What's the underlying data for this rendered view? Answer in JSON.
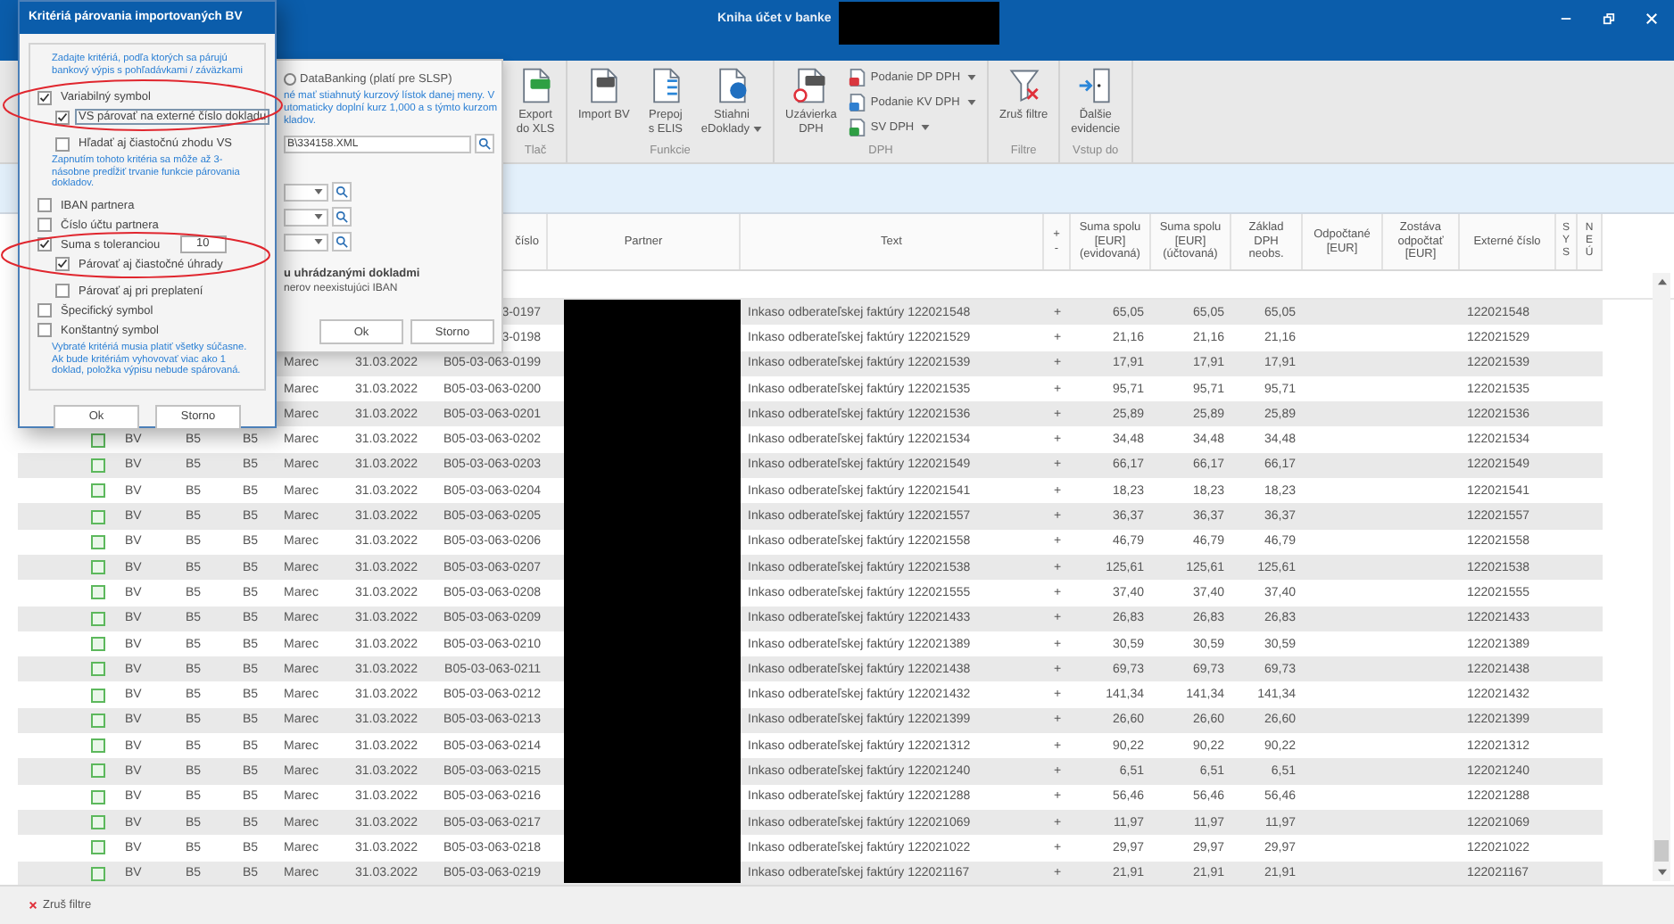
{
  "window": {
    "title": "Kniha účet v banke"
  },
  "ribbon": {
    "groups": [
      {
        "label": "Tlač",
        "items": [
          {
            "kind": "large",
            "label": "Export\ndo XLS",
            "dropdown": false
          }
        ]
      },
      {
        "label": "Funkcie",
        "items": [
          {
            "kind": "large",
            "label": "Import BV",
            "dropdown": false
          },
          {
            "kind": "large",
            "label": "Prepoj\ns ELIS",
            "dropdown": false
          },
          {
            "kind": "large",
            "label": "Stiahni\neDoklady",
            "dropdown": true
          }
        ]
      },
      {
        "label": "DPH",
        "items": [
          {
            "kind": "large",
            "label": "Uzávierka\nDPH",
            "dropdown": false
          },
          {
            "kind": "stack",
            "items": [
              {
                "label": "Podanie DP DPH",
                "dropdown": true
              },
              {
                "label": "Podanie KV DPH",
                "dropdown": true
              },
              {
                "label": "SV DPH",
                "dropdown": true
              }
            ]
          }
        ]
      },
      {
        "label": "Filtre",
        "items": [
          {
            "kind": "large",
            "label": "Zruš filtre",
            "dropdown": false
          }
        ]
      },
      {
        "label": "Vstup do",
        "items": [
          {
            "kind": "large",
            "label": "Ďalšie\nevidencie",
            "dropdown": false
          }
        ]
      }
    ]
  },
  "table": {
    "columns": [
      "číslo",
      "Partner",
      "Text",
      "+\n-",
      "Suma spolu\n[EUR]\n(evidovaná)",
      "Suma spolu\n[EUR]\n(účtovaná)",
      "Základ\nDPH\nneobs.",
      "Odpočtané\n[EUR]",
      "Zostáva\nodpočtať\n[EUR]",
      "Externé číslo",
      "S\nY\nS",
      "N\nE\nÚ"
    ],
    "rows": [
      {
        "number": "3-0197",
        "text": "Inkaso odberateľskej faktúry 122021548",
        "sign": "+",
        "sum_recorded": "65,05",
        "sum_posted": "65,05",
        "vat_base": "65,05",
        "external_number": "122021548"
      },
      {
        "number": "3-0198",
        "text": "Inkaso odberateľskej faktúry 122021529",
        "sign": "+",
        "sum_recorded": "21,16",
        "sum_posted": "21,16",
        "vat_base": "21,16",
        "external_number": "122021529"
      },
      {
        "column_4": "Marec",
        "column_5": "31.03.2022",
        "number": "B05-03-063-0199",
        "text": "Inkaso odberateľskej faktúry 122021539",
        "sign": "+",
        "sum_recorded": "17,91",
        "sum_posted": "17,91",
        "vat_base": "17,91",
        "external_number": "122021539"
      },
      {
        "column_4": "Marec",
        "column_5": "31.03.2022",
        "number": "B05-03-063-0200",
        "text": "Inkaso odberateľskej faktúry 122021535",
        "sign": "+",
        "sum_recorded": "95,71",
        "sum_posted": "95,71",
        "vat_base": "95,71",
        "external_number": "122021535"
      },
      {
        "column_4": "Marec",
        "column_5": "31.03.2022",
        "number": "B05-03-063-0201",
        "text": "Inkaso odberateľskej faktúry 122021536",
        "sign": "+",
        "sum_recorded": "25,89",
        "sum_posted": "25,89",
        "vat_base": "25,89",
        "external_number": "122021536"
      },
      {
        "column_1": "BV",
        "column_2": "B5",
        "column_3": "B5",
        "column_4": "Marec",
        "column_5": "31.03.2022",
        "checked": false,
        "number": "B05-03-063-0202",
        "text": "Inkaso odberateľskej faktúry 122021534",
        "sign": "+",
        "sum_recorded": "34,48",
        "sum_posted": "34,48",
        "vat_base": "34,48",
        "external_number": "122021534"
      },
      {
        "column_1": "BV",
        "column_2": "B5",
        "column_3": "B5",
        "column_4": "Marec",
        "column_5": "31.03.2022",
        "checked": false,
        "number": "B05-03-063-0203",
        "text": "Inkaso odberateľskej faktúry 122021549",
        "sign": "+",
        "sum_recorded": "66,17",
        "sum_posted": "66,17",
        "vat_base": "66,17",
        "external_number": "122021549"
      },
      {
        "column_1": "BV",
        "column_2": "B5",
        "column_3": "B5",
        "column_4": "Marec",
        "column_5": "31.03.2022",
        "checked": false,
        "number": "B05-03-063-0204",
        "text": "Inkaso odberateľskej faktúry 122021541",
        "sign": "+",
        "sum_recorded": "18,23",
        "sum_posted": "18,23",
        "vat_base": "18,23",
        "external_number": "122021541"
      },
      {
        "column_1": "BV",
        "column_2": "B5",
        "column_3": "B5",
        "column_4": "Marec",
        "column_5": "31.03.2022",
        "checked": false,
        "number": "B05-03-063-0205",
        "text": "Inkaso odberateľskej faktúry 122021557",
        "sign": "+",
        "sum_recorded": "36,37",
        "sum_posted": "36,37",
        "vat_base": "36,37",
        "external_number": "122021557"
      },
      {
        "column_1": "BV",
        "column_2": "B5",
        "column_3": "B5",
        "column_4": "Marec",
        "column_5": "31.03.2022",
        "checked": false,
        "number": "B05-03-063-0206",
        "text": "Inkaso odberateľskej faktúry 122021558",
        "sign": "+",
        "sum_recorded": "46,79",
        "sum_posted": "46,79",
        "vat_base": "46,79",
        "external_number": "122021558"
      },
      {
        "column_1": "BV",
        "column_2": "B5",
        "column_3": "B5",
        "column_4": "Marec",
        "column_5": "31.03.2022",
        "checked": false,
        "number": "B05-03-063-0207",
        "text": "Inkaso odberateľskej faktúry 122021538",
        "sign": "+",
        "sum_recorded": "125,61",
        "sum_posted": "125,61",
        "vat_base": "125,61",
        "external_number": "122021538"
      },
      {
        "column_1": "BV",
        "column_2": "B5",
        "column_3": "B5",
        "column_4": "Marec",
        "column_5": "31.03.2022",
        "checked": false,
        "number": "B05-03-063-0208",
        "text": "Inkaso odberateľskej faktúry 122021555",
        "sign": "+",
        "sum_recorded": "37,40",
        "sum_posted": "37,40",
        "vat_base": "37,40",
        "external_number": "122021555"
      },
      {
        "column_1": "BV",
        "column_2": "B5",
        "column_3": "B5",
        "column_4": "Marec",
        "column_5": "31.03.2022",
        "checked": false,
        "number": "B05-03-063-0209",
        "text": "Inkaso odberateľskej faktúry 122021433",
        "sign": "+",
        "sum_recorded": "26,83",
        "sum_posted": "26,83",
        "vat_base": "26,83",
        "external_number": "122021433"
      },
      {
        "column_1": "BV",
        "column_2": "B5",
        "column_3": "B5",
        "column_4": "Marec",
        "column_5": "31.03.2022",
        "checked": false,
        "number": "B05-03-063-0210",
        "text": "Inkaso odberateľskej faktúry 122021389",
        "sign": "+",
        "sum_recorded": "30,59",
        "sum_posted": "30,59",
        "vat_base": "30,59",
        "external_number": "122021389"
      },
      {
        "column_1": "BV",
        "column_2": "B5",
        "column_3": "B5",
        "column_4": "Marec",
        "column_5": "31.03.2022",
        "checked": false,
        "number": "B05-03-063-0211",
        "text": "Inkaso odberateľskej faktúry 122021438",
        "sign": "+",
        "sum_recorded": "69,73",
        "sum_posted": "69,73",
        "vat_base": "69,73",
        "external_number": "122021438"
      },
      {
        "column_1": "BV",
        "column_2": "B5",
        "column_3": "B5",
        "column_4": "Marec",
        "column_5": "31.03.2022",
        "checked": false,
        "number": "B05-03-063-0212",
        "text": "Inkaso odberateľskej faktúry 122021432",
        "sign": "+",
        "sum_recorded": "141,34",
        "sum_posted": "141,34",
        "vat_base": "141,34",
        "external_number": "122021432"
      },
      {
        "column_1": "BV",
        "column_2": "B5",
        "column_3": "B5",
        "column_4": "Marec",
        "column_5": "31.03.2022",
        "checked": false,
        "number": "B05-03-063-0213",
        "text": "Inkaso odberateľskej faktúry 122021399",
        "sign": "+",
        "sum_recorded": "26,60",
        "sum_posted": "26,60",
        "vat_base": "26,60",
        "external_number": "122021399"
      },
      {
        "column_1": "BV",
        "column_2": "B5",
        "column_3": "B5",
        "column_4": "Marec",
        "column_5": "31.03.2022",
        "checked": false,
        "number": "B05-03-063-0214",
        "text": "Inkaso odberateľskej faktúry 122021312",
        "sign": "+",
        "sum_recorded": "90,22",
        "sum_posted": "90,22",
        "vat_base": "90,22",
        "external_number": "122021312"
      },
      {
        "column_1": "BV",
        "column_2": "B5",
        "column_3": "B5",
        "column_4": "Marec",
        "column_5": "31.03.2022",
        "checked": false,
        "number": "B05-03-063-0215",
        "text": "Inkaso odberateľskej faktúry 122021240",
        "sign": "+",
        "sum_recorded": "6,51",
        "sum_posted": "6,51",
        "vat_base": "6,51",
        "external_number": "122021240"
      },
      {
        "column_1": "BV",
        "column_2": "B5",
        "column_3": "B5",
        "column_4": "Marec",
        "column_5": "31.03.2022",
        "checked": false,
        "number": "B05-03-063-0216",
        "text": "Inkaso odberateľskej faktúry 122021288",
        "sign": "+",
        "sum_recorded": "56,46",
        "sum_posted": "56,46",
        "vat_base": "56,46",
        "external_number": "122021288"
      },
      {
        "column_1": "BV",
        "column_2": "B5",
        "column_3": "B5",
        "column_4": "Marec",
        "column_5": "31.03.2022",
        "checked": false,
        "number": "B05-03-063-0217",
        "text": "Inkaso odberateľskej faktúry 122021069",
        "sign": "+",
        "sum_recorded": "11,97",
        "sum_posted": "11,97",
        "vat_base": "11,97",
        "external_number": "122021069"
      },
      {
        "column_1": "BV",
        "column_2": "B5",
        "column_3": "B5",
        "column_4": "Marec",
        "column_5": "31.03.2022",
        "checked": false,
        "number": "B05-03-063-0218",
        "text": "Inkaso odberateľskej faktúry 122021022",
        "sign": "+",
        "sum_recorded": "29,97",
        "sum_posted": "29,97",
        "vat_base": "29,97",
        "external_number": "122021022"
      },
      {
        "column_1": "BV",
        "column_2": "B5",
        "column_3": "B5",
        "column_4": "Marec",
        "column_5": "31.03.2022",
        "checked": false,
        "number": "B05-03-063-0219",
        "text": "Inkaso odberateľskej faktúry 122021167",
        "sign": "+",
        "sum_recorded": "21,91",
        "sum_posted": "21,91",
        "vat_base": "21,91",
        "external_number": "122021167"
      }
    ]
  },
  "status_bar": {
    "clear_filter": "Zruš filtre"
  },
  "import_dialog": {
    "radio": {
      "label": "DataBanking (platí pre SLSP)",
      "selected": false
    },
    "note_lines": [
      "né mať stiahnutý kurzový lístok danej meny. V",
      "utomaticky doplní kurz 1,000 a s týmto kurzom",
      "kladov."
    ],
    "file_path": "B\\334158.XML",
    "dropdowns": [
      {
        "kind": "dropdown"
      },
      {
        "kind": "dropdown"
      },
      {
        "kind": "dropdown"
      }
    ],
    "bold_text": "u uhrádzanými dokladmi",
    "info_text": "nerov neexistujúci IBAN",
    "buttons": [
      "Ok",
      "Storno"
    ]
  },
  "criteria_dialog": {
    "title": "Kritériá párovania importovaných BV",
    "intro": "Zadajte kritériá, podľa ktorých sa párujú bankový výpis s pohľadávkami / záväzkami",
    "criteria": [
      {
        "label": "Variabilný symbol",
        "checked": true,
        "children": [
          {
            "label": "VS párovať na externé číslo dokladu",
            "checked": true,
            "focused": true
          },
          {
            "label": "Hľadať aj čiastočnú zhodu VS",
            "checked": false,
            "focused": false
          }
        ],
        "note": "Zapnutím tohoto kritéria sa môže až 3-násobne predĺžiť trvanie funkcie párovania dokladov."
      },
      {
        "label": "IBAN partnera",
        "checked": false
      },
      {
        "label": "Číslo účtu partnera",
        "checked": false
      },
      {
        "label": "Suma s toleranciou",
        "checked": true,
        "tolerance": "10",
        "children": [
          {
            "label": "Párovať aj čiastočné úhrady",
            "checked": true,
            "focused": false
          },
          {
            "label": "Párovať aj pri preplatení",
            "checked": false,
            "focused": false
          }
        ]
      },
      {
        "label": "Špecifický symbol",
        "checked": false
      },
      {
        "label": "Konštantný symbol",
        "checked": false
      }
    ],
    "footer_note": "Vybraté kritériá musia platiť všetky súčasne. Ak bude kritériám vyhovovať viac ako 1 doklad, položka výpisu nebude spárovaná.",
    "buttons": [
      "Ok",
      "Storno"
    ]
  }
}
